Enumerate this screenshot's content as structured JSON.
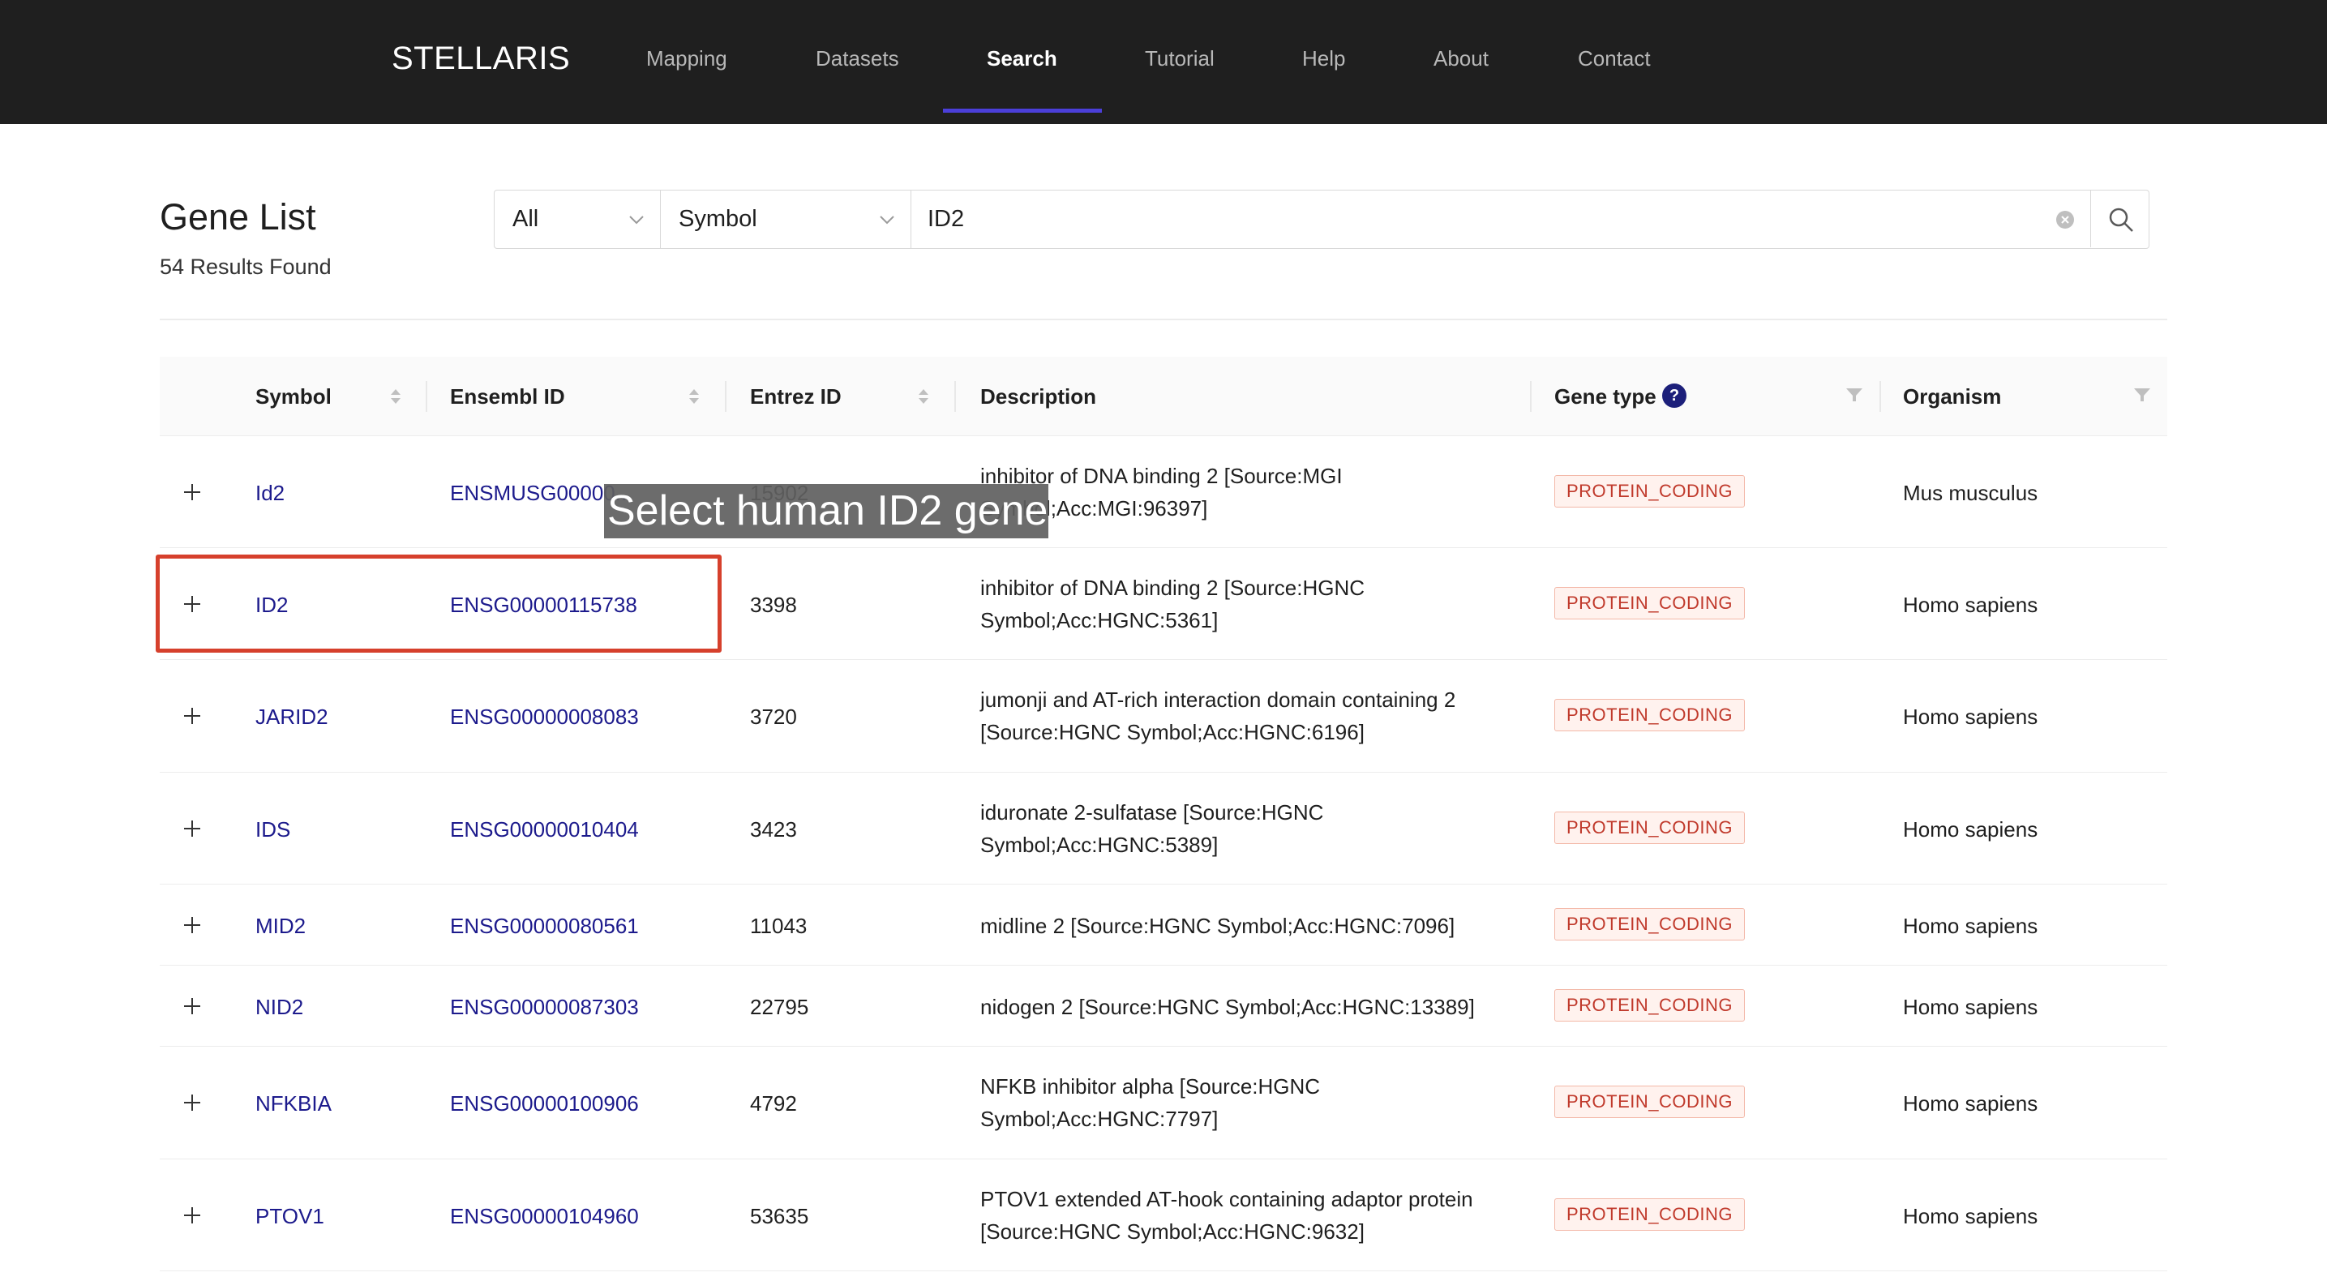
{
  "app": {
    "brand": "STELLARIS"
  },
  "nav": {
    "items": [
      {
        "label": "Mapping",
        "active": false
      },
      {
        "label": "Datasets",
        "active": false
      },
      {
        "label": "Search",
        "active": true
      },
      {
        "label": "Tutorial",
        "active": false
      },
      {
        "label": "Help",
        "active": false
      },
      {
        "label": "About",
        "active": false
      },
      {
        "label": "Contact",
        "active": false
      }
    ]
  },
  "header": {
    "title": "Gene List",
    "results": "54 Results Found"
  },
  "search": {
    "scope": "All",
    "field": "Symbol",
    "query": "ID2"
  },
  "table": {
    "columns": {
      "symbol": "Symbol",
      "ensembl": "Ensembl ID",
      "entrez": "Entrez ID",
      "description": "Description",
      "gene_type": "Gene type",
      "organism": "Organism"
    },
    "help_glyph": "?",
    "rows": [
      {
        "symbol": "Id2",
        "ensembl": "ENSMUSG00000...",
        "entrez": "15902",
        "description": "inhibitor of DNA binding 2 [Source:MGI Symbol;Acc:MGI:96397]",
        "gene_type": "PROTEIN_CODING",
        "organism": "Mus musculus"
      },
      {
        "symbol": "ID2",
        "ensembl": "ENSG00000115738",
        "entrez": "3398",
        "description": "inhibitor of DNA binding 2 [Source:HGNC Symbol;Acc:HGNC:5361]",
        "gene_type": "PROTEIN_CODING",
        "organism": "Homo sapiens"
      },
      {
        "symbol": "JARID2",
        "ensembl": "ENSG00000008083",
        "entrez": "3720",
        "description": "jumonji and AT-rich interaction domain containing 2 [Source:HGNC Symbol;Acc:HGNC:6196]",
        "gene_type": "PROTEIN_CODING",
        "organism": "Homo sapiens"
      },
      {
        "symbol": "IDS",
        "ensembl": "ENSG00000010404",
        "entrez": "3423",
        "description": "iduronate 2-sulfatase [Source:HGNC Symbol;Acc:HGNC:5389]",
        "gene_type": "PROTEIN_CODING",
        "organism": "Homo sapiens"
      },
      {
        "symbol": "MID2",
        "ensembl": "ENSG00000080561",
        "entrez": "11043",
        "description": "midline 2 [Source:HGNC Symbol;Acc:HGNC:7096]",
        "gene_type": "PROTEIN_CODING",
        "organism": "Homo sapiens"
      },
      {
        "symbol": "NID2",
        "ensembl": "ENSG00000087303",
        "entrez": "22795",
        "description": "nidogen 2 [Source:HGNC Symbol;Acc:HGNC:13389]",
        "gene_type": "PROTEIN_CODING",
        "organism": "Homo sapiens"
      },
      {
        "symbol": "NFKBIA",
        "ensembl": "ENSG00000100906",
        "entrez": "4792",
        "description": "NFKB inhibitor alpha [Source:HGNC Symbol;Acc:HGNC:7797]",
        "gene_type": "PROTEIN_CODING",
        "organism": "Homo sapiens"
      },
      {
        "symbol": "PTOV1",
        "ensembl": "ENSG00000104960",
        "entrez": "53635",
        "description": "PTOV1 extended AT-hook containing adaptor protein [Source:HGNC Symbol;Acc:HGNC:9632]",
        "gene_type": "PROTEIN_CODING",
        "organism": "Homo sapiens"
      }
    ]
  },
  "annotation": {
    "callout": "Select human ID2 gene"
  },
  "colors": {
    "navbar_bg": "#1f1f1f",
    "nav_active_underline": "#4b3fd9",
    "link": "#1c1a8c",
    "tag_text": "#c0392b",
    "highlight_border": "#d6402c"
  }
}
